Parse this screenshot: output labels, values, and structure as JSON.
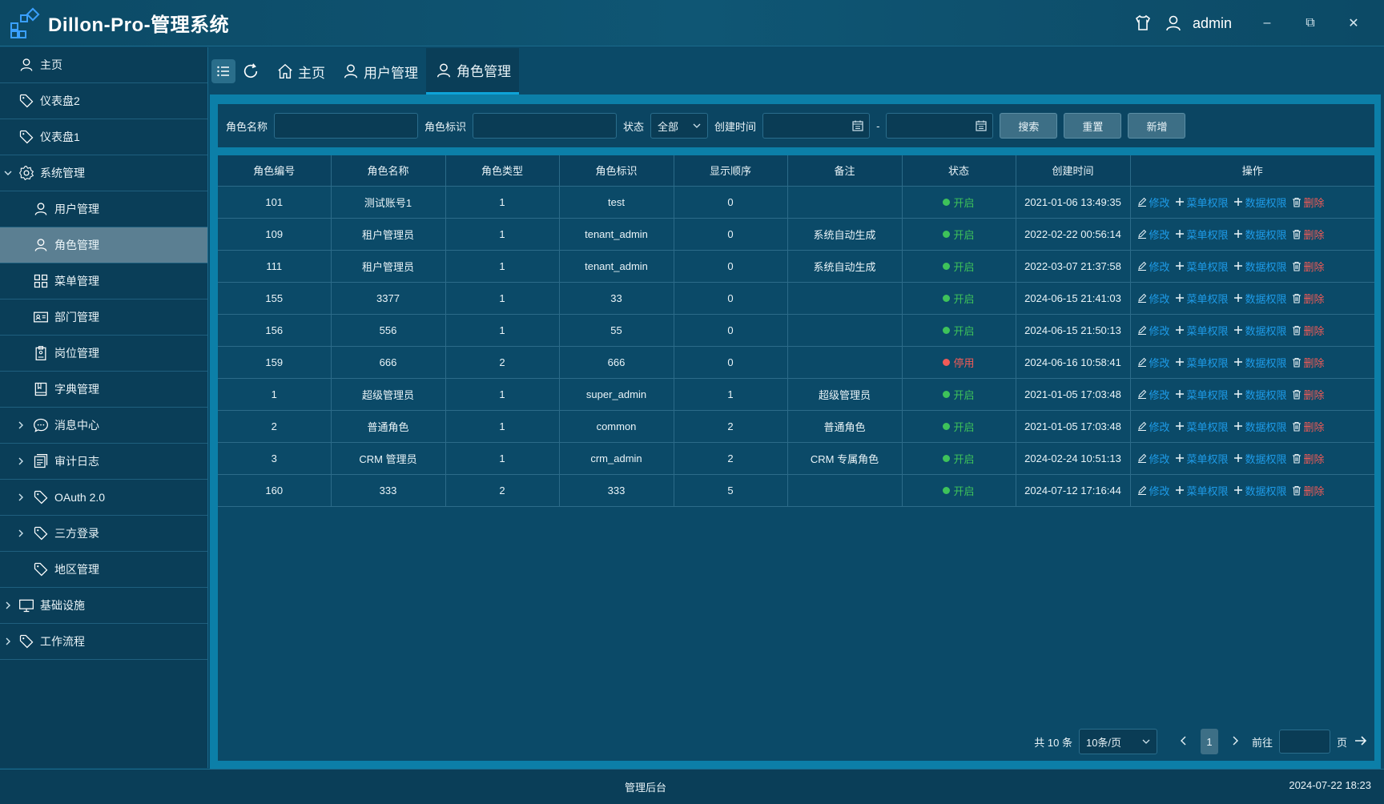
{
  "app": {
    "title": "Dillon-Pro-管理系统",
    "user": "admin"
  },
  "window": {
    "minimize": "–",
    "restore": "⧉",
    "close": "✕"
  },
  "sidebar": {
    "items": [
      {
        "label": "主页",
        "icon": "user-icon"
      },
      {
        "label": "仪表盘2",
        "icon": "tag-icon"
      },
      {
        "label": "仪表盘1",
        "icon": "tag-icon"
      },
      {
        "label": "系统管理",
        "icon": "gear-icon",
        "expanded": true
      },
      {
        "label": "用户管理",
        "icon": "user-icon"
      },
      {
        "label": "角色管理",
        "icon": "user-icon",
        "active": true
      },
      {
        "label": "菜单管理",
        "icon": "grid-icon"
      },
      {
        "label": "部门管理",
        "icon": "id-card-icon"
      },
      {
        "label": "岗位管理",
        "icon": "clipboard-icon"
      },
      {
        "label": "字典管理",
        "icon": "book-icon"
      },
      {
        "label": "消息中心",
        "icon": "chat-icon"
      },
      {
        "label": "审计日志",
        "icon": "document-icon"
      },
      {
        "label": "OAuth 2.0",
        "icon": "tag-icon"
      },
      {
        "label": "三方登录",
        "icon": "tag-icon"
      },
      {
        "label": "地区管理",
        "icon": "tag-icon"
      },
      {
        "label": "基础设施",
        "icon": "monitor-icon"
      },
      {
        "label": "工作流程",
        "icon": "tag-icon"
      }
    ]
  },
  "tabs": [
    {
      "label": "主页"
    },
    {
      "label": "用户管理"
    },
    {
      "label": "角色管理",
      "active": true
    }
  ],
  "search": {
    "role_name_label": "角色名称",
    "role_key_label": "角色标识",
    "status_label": "状态",
    "status_value": "全部",
    "created_label": "创建时间",
    "range_sep": "-",
    "search_btn": "搜索",
    "reset_btn": "重置",
    "add_btn": "新增"
  },
  "table": {
    "headers": [
      "角色编号",
      "角色名称",
      "角色类型",
      "角色标识",
      "显示顺序",
      "备注",
      "状态",
      "创建时间",
      "操作"
    ],
    "rows": [
      {
        "id": "101",
        "name": "测试账号1",
        "type": "1",
        "key": "test",
        "order": "0",
        "remark": "",
        "status": "开启",
        "created": "2021-01-06 13:49:35"
      },
      {
        "id": "109",
        "name": "租户管理员",
        "type": "1",
        "key": "tenant_admin",
        "order": "0",
        "remark": "系统自动生成",
        "status": "开启",
        "created": "2022-02-22 00:56:14"
      },
      {
        "id": "111",
        "name": "租户管理员",
        "type": "1",
        "key": "tenant_admin",
        "order": "0",
        "remark": "系统自动生成",
        "status": "开启",
        "created": "2022-03-07 21:37:58"
      },
      {
        "id": "155",
        "name": "3377",
        "type": "1",
        "key": "33",
        "order": "0",
        "remark": "",
        "status": "开启",
        "created": "2024-06-15 21:41:03"
      },
      {
        "id": "156",
        "name": "556",
        "type": "1",
        "key": "55",
        "order": "0",
        "remark": "",
        "status": "开启",
        "created": "2024-06-15 21:50:13"
      },
      {
        "id": "159",
        "name": "666",
        "type": "2",
        "key": "666",
        "order": "0",
        "remark": "",
        "status": "停用",
        "created": "2024-06-16 10:58:41"
      },
      {
        "id": "1",
        "name": "超级管理员",
        "type": "1",
        "key": "super_admin",
        "order": "1",
        "remark": "超级管理员",
        "status": "开启",
        "created": "2021-01-05 17:03:48"
      },
      {
        "id": "2",
        "name": "普通角色",
        "type": "1",
        "key": "common",
        "order": "2",
        "remark": "普通角色",
        "status": "开启",
        "created": "2021-01-05 17:03:48"
      },
      {
        "id": "3",
        "name": "CRM 管理员",
        "type": "1",
        "key": "crm_admin",
        "order": "2",
        "remark": "CRM 专属角色",
        "status": "开启",
        "created": "2024-02-24 10:51:13"
      },
      {
        "id": "160",
        "name": "333",
        "type": "2",
        "key": "333",
        "order": "5",
        "remark": "",
        "status": "开启",
        "created": "2024-07-12 17:16:44"
      }
    ],
    "actions": {
      "edit": "修改",
      "menu_perm": "菜单权限",
      "data_perm": "数据权限",
      "delete": "删除"
    }
  },
  "pagination": {
    "total": "共 10 条",
    "page_size": "10条/页",
    "current": "1",
    "goto_label": "前往",
    "page_suffix": "页"
  },
  "footer": {
    "center": "管理后台",
    "datetime": "2024-07-22 18:23"
  },
  "colors": {
    "on": "#3ec25a",
    "off": "#f25b57",
    "link": "#1e9be8"
  }
}
